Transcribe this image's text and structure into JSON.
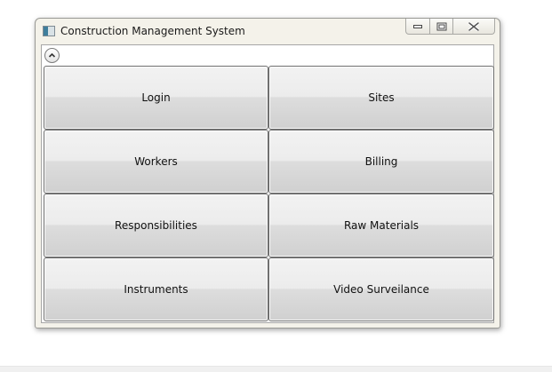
{
  "window": {
    "title": "Construction Management System",
    "icons": {
      "app": "app-window-icon",
      "minimize": "minimize-icon",
      "maximize": "maximize-icon",
      "close": "close-icon",
      "collapse": "chevron-up-icon"
    }
  },
  "tiles": [
    {
      "label": "Login"
    },
    {
      "label": "Sites"
    },
    {
      "label": "Workers"
    },
    {
      "label": "Billing"
    },
    {
      "label": "Responsibilities"
    },
    {
      "label": "Raw Materials"
    },
    {
      "label": "Instruments"
    },
    {
      "label": "Video Surveilance"
    }
  ],
  "colors": {
    "tile_top": "#f2f2f2",
    "tile_bottom": "#d0d0d0",
    "window_frame": "#f4f2ea"
  }
}
